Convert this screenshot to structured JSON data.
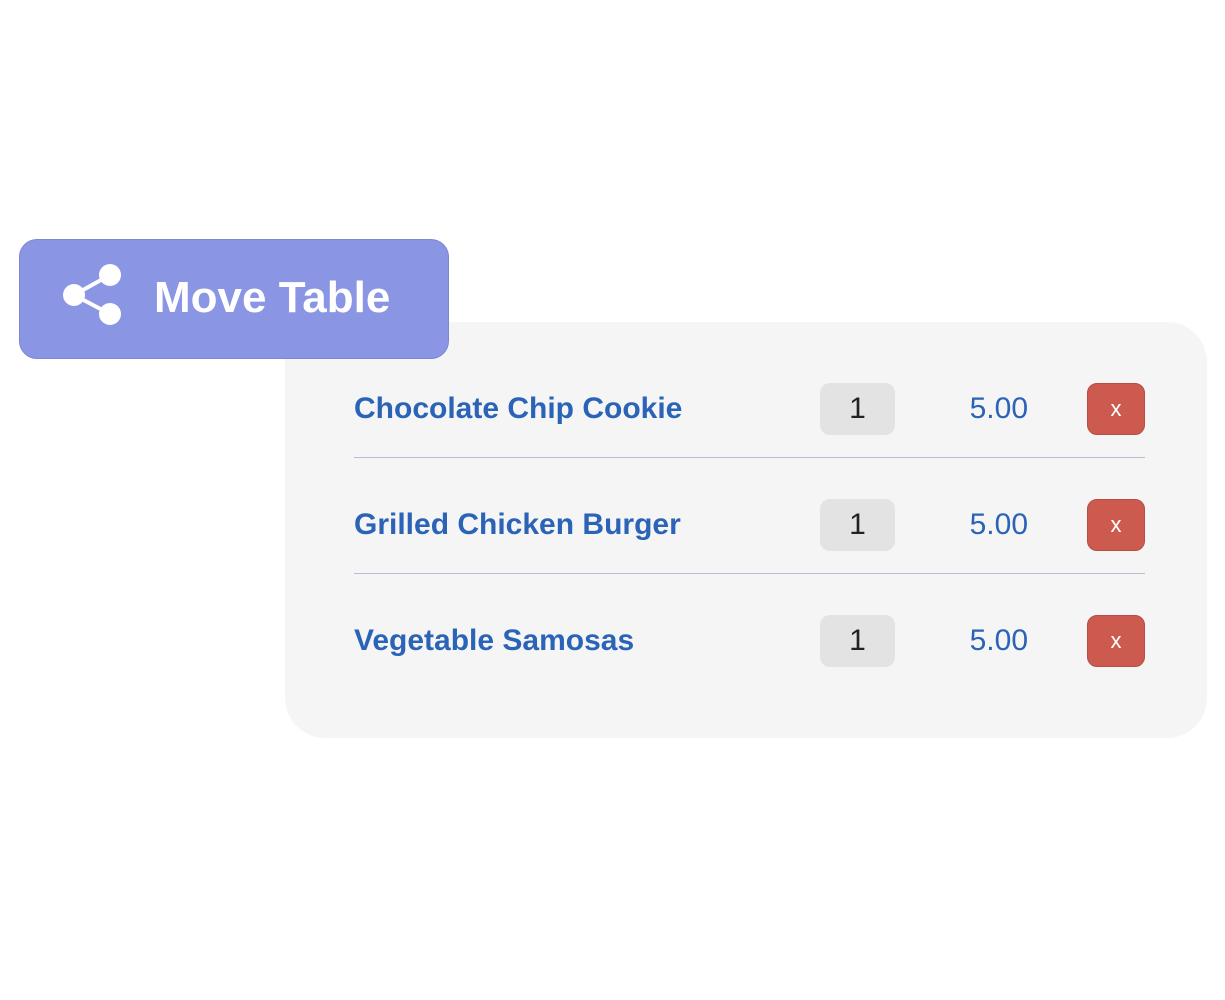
{
  "move_table_button": {
    "label": "Move Table",
    "icon": "share-icon"
  },
  "order": {
    "items": [
      {
        "name": "Chocolate Chip Cookie",
        "quantity": "1",
        "price": "5.00",
        "remove_label": "x"
      },
      {
        "name": "Grilled Chicken Burger",
        "quantity": "1",
        "price": "5.00",
        "remove_label": "x"
      },
      {
        "name": "Vegetable Samosas",
        "quantity": "1",
        "price": "5.00",
        "remove_label": "x"
      }
    ]
  },
  "colors": {
    "accent": "#8a95e3",
    "item_text": "#2b63b7",
    "remove": "#cd5a4f",
    "card_bg": "#f5f5f5",
    "qty_bg": "#e3e3e3"
  }
}
